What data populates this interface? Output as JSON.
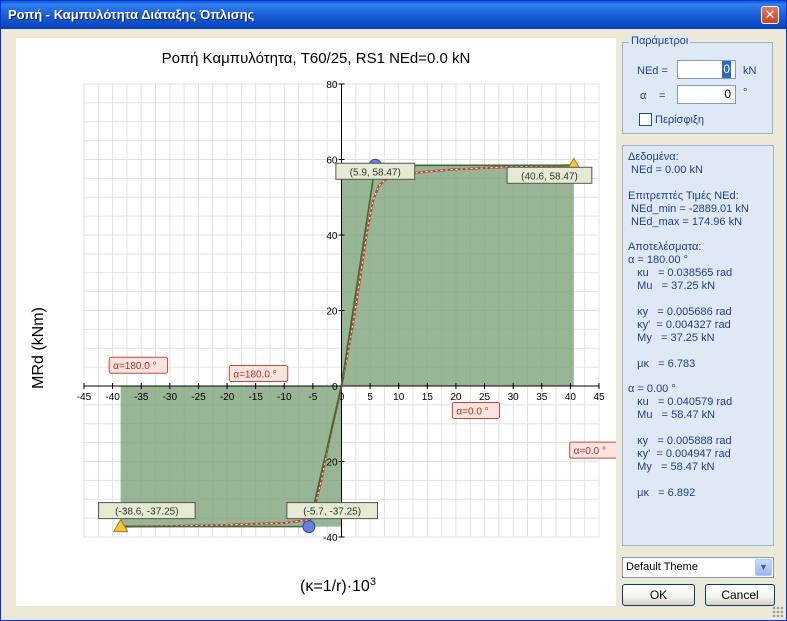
{
  "window": {
    "title": "Ροπή - Καμπυλότητα Διάταξης Όπλισης",
    "close_symbol": "✕"
  },
  "parameters": {
    "legend": "Παράμετροι",
    "ned_label": "NEd =",
    "ned_value": "0",
    "ned_unit": "kN",
    "alpha_label": "α",
    "alpha_eq": "=",
    "alpha_value": "0",
    "alpha_unit": "°",
    "confinement_label": "Περίσφιξη",
    "confinement_checked": false
  },
  "results": {
    "lines": [
      "Δεδομένα:",
      " NEd = 0.00 kN",
      "",
      "Επιτρεπτές Τιμές NEd:",
      " NEd_min = -2889.01 kN",
      " NEd_max = 174.96 kN",
      "",
      "Αποτελέσματα:",
      "α = 180.00 °",
      "   κu   = 0.038565 rad",
      "   Mu   = 37.25 kN",
      "",
      "   κy   = 0.005686 rad",
      "   κy'  = 0.004327 rad",
      "   My   = 37.25 kN",
      "",
      "   μκ   = 6.783",
      "",
      "α = 0.00 °",
      "   κu   = 0.040579 rad",
      "   Mu   = 58.47 kN",
      "",
      "   κy   = 0.005888 rad",
      "   κy'  = 0.004947 rad",
      "   My   = 58.47 kN",
      "",
      "   μκ   = 6.892"
    ]
  },
  "theme": {
    "selected": "Default Theme"
  },
  "buttons": {
    "ok": "OK",
    "cancel": "Cancel"
  },
  "colors": {
    "fill_area": "#7ea27c",
    "curve": "#b94a3a",
    "bilinear": "#3a6b35",
    "grid": "#e2e2e2",
    "label_bg": "#fbe3df",
    "label_border": "#c9473e",
    "coord_bg": "#e5ebd2"
  },
  "chart_data": {
    "type": "line",
    "title": "Ροπή Καμπυλότητα, T60/25, RS1 NEd=0.0 kN",
    "xlabel": "(κ=1/r)·10",
    "xlabel_sup": "3",
    "ylabel": "MRd (kNm)",
    "xlim": [
      -45,
      45
    ],
    "ylim": [
      -40,
      80
    ],
    "xticks": [
      -45,
      -40,
      -35,
      -30,
      -25,
      -20,
      -15,
      -10,
      -5,
      0,
      5,
      10,
      15,
      20,
      25,
      30,
      35,
      40,
      45
    ],
    "yticks": [
      -40,
      -20,
      0,
      20,
      40,
      60,
      80
    ],
    "grid": true,
    "series": [
      {
        "name": "",
        "kind": "curve",
        "x": [
          -38.6,
          -30,
          -20,
          -10,
          -6,
          -4.5,
          -3.5,
          -2.5,
          -1.5,
          -0.5,
          0,
          0.5,
          1.5,
          2.5,
          3.5,
          4.5,
          5.5,
          6.5,
          8,
          10,
          15,
          20,
          30,
          40.6
        ],
        "y": [
          -37.25,
          -37.1,
          -36.8,
          -36.3,
          -35.5,
          -31,
          -25,
          -17,
          -10,
          -3.5,
          0,
          4,
          12,
          21,
          31,
          41,
          49,
          53,
          55,
          56,
          56.8,
          57.4,
          58.1,
          58.47
        ]
      },
      {
        "name": "",
        "kind": "bilinear",
        "x": [
          -38.6,
          -5.7,
          0,
          5.9,
          40.6
        ],
        "y": [
          -37.25,
          -37.25,
          0,
          58.47,
          58.47
        ]
      }
    ],
    "markers": [
      {
        "shape": "circle",
        "x": 5.9,
        "y": 58.47
      },
      {
        "shape": "triangle",
        "x": 40.6,
        "y": 58.47
      },
      {
        "shape": "triangle",
        "x": -38.6,
        "y": -37.25
      },
      {
        "shape": "circle",
        "x": -5.7,
        "y": -37.25
      }
    ],
    "coord_labels": [
      {
        "text": "(5.9, 58.47)",
        "x": 5.9,
        "y": 58.47,
        "anchor": "center"
      },
      {
        "text": "(40.6, 58.47)",
        "x": 40.6,
        "y": 58.47,
        "anchor": "right"
      },
      {
        "text": "(-38.6, -37.25)",
        "x": -38.6,
        "y": -37.25,
        "anchor": "left-up"
      },
      {
        "text": "(-5.7, -37.25)",
        "x": -5.7,
        "y": -37.25,
        "anchor": "left-up"
      }
    ],
    "angle_labels": [
      {
        "text": "α=180.0 °",
        "x": -35.5,
        "y": 5.5
      },
      {
        "text": "α=180.0 °",
        "x": -14.5,
        "y": 3.3
      },
      {
        "text": "α=0.0 °",
        "x": 23.5,
        "y": -6.5
      },
      {
        "text": "α=0.0 °",
        "x": 44,
        "y": -17
      }
    ]
  }
}
